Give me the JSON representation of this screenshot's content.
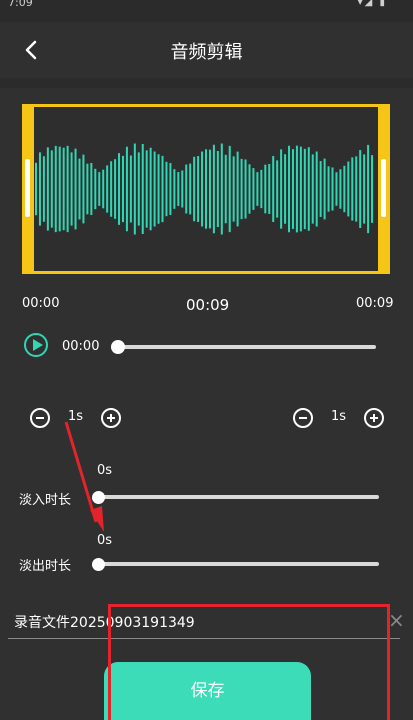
{
  "status_bar": {
    "time": "7:09",
    "icons": "▾◢ ▮"
  },
  "header": {
    "title": "音频剪辑",
    "back_icon": "chevron-left-icon"
  },
  "waveform": {
    "start_time": "00:00",
    "current_time": "00:09",
    "end_time": "00:09",
    "frame_color": "#f5c518",
    "wave_color": "#2fd7b4"
  },
  "player": {
    "position_time": "00:00",
    "play_icon": "play-icon",
    "progress": 0
  },
  "fade_in_step": {
    "value": "1s",
    "minus_icon": "minus-circle-icon",
    "plus_icon": "plus-circle-icon"
  },
  "fade_out_step": {
    "value": "1s",
    "minus_icon": "minus-circle-icon",
    "plus_icon": "plus-circle-icon"
  },
  "fade_in": {
    "label": "淡入时长",
    "value": "0s",
    "level": 0
  },
  "fade_out": {
    "label": "淡出时长",
    "value": "0s",
    "level": 0
  },
  "file": {
    "name": "录音文件20250903191349",
    "clear_icon": "close-icon"
  },
  "save_button": {
    "label": "保存",
    "color": "#3cdcb8"
  },
  "annotations": {
    "highlight_color": "#e3242b"
  }
}
